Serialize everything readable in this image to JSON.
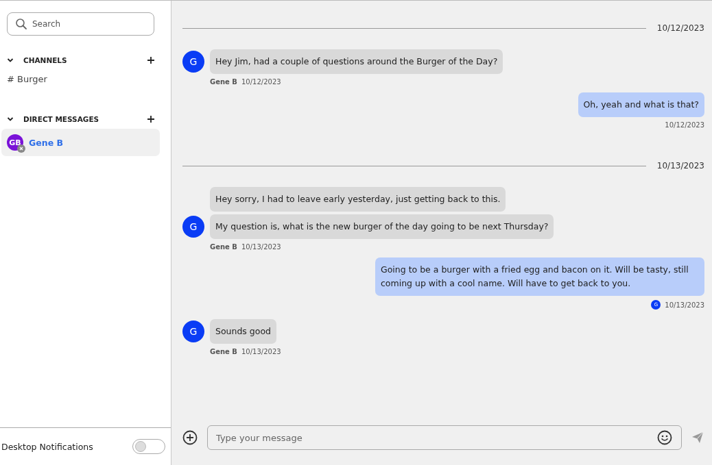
{
  "sidebar": {
    "search": {
      "placeholder": "Search"
    },
    "sections": [
      {
        "title": "CHANNELS",
        "expanded": true,
        "items": [
          {
            "kind": "channel",
            "label": "# Burger",
            "selected": false
          }
        ]
      },
      {
        "title": "DIRECT MESSAGES",
        "expanded": true,
        "items": [
          {
            "kind": "dm",
            "label": "Gene B",
            "avatar": "GB",
            "selected": true
          }
        ]
      }
    ],
    "notifications": {
      "label": "Desktop Notifications",
      "on": false
    }
  },
  "messages": [
    {
      "kind": "divider",
      "date": "10/12/2023"
    },
    {
      "kind": "incoming",
      "avatar": "G",
      "bubbles": [
        "Hey Jim, had a couple of questions around the Burger of the Day?"
      ],
      "sender": "Gene B",
      "time": "10/12/2023"
    },
    {
      "kind": "outgoing",
      "text": "Oh, yeah and what is that?",
      "time": "10/12/2023"
    },
    {
      "kind": "divider",
      "date": "10/13/2023"
    },
    {
      "kind": "incoming",
      "avatar": "G",
      "bubbles": [
        "Hey sorry, I had to leave early yesterday, just getting back to this.",
        "My question is, what is the new burger of the day going to be next Thursday?"
      ],
      "sender": "Gene B",
      "time": "10/13/2023"
    },
    {
      "kind": "outgoing",
      "text": "Going to be a burger with a fried egg and bacon on it. Will be tasty, still coming up with a cool name. Will have to get back to you.",
      "time": "10/13/2023",
      "read_by": "G"
    },
    {
      "kind": "incoming",
      "avatar": "G",
      "bubbles": [
        "Sounds good"
      ],
      "sender": "Gene B",
      "time": "10/13/2023"
    }
  ],
  "composer": {
    "placeholder": "Type your message"
  }
}
